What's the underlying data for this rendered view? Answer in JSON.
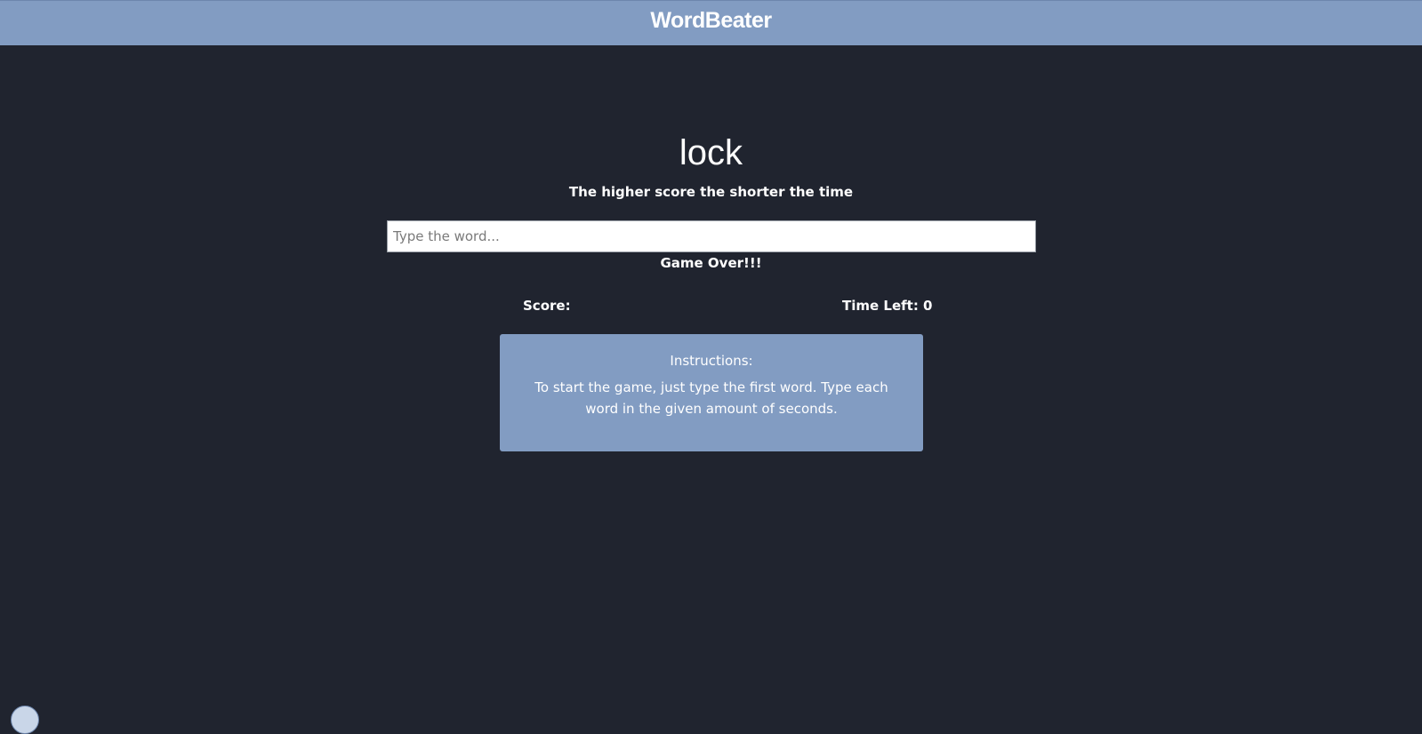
{
  "header": {
    "brand": "WordBeater"
  },
  "game": {
    "current_word": "lock",
    "tagline": "The higher score the shorter the time",
    "input_value": "",
    "input_placeholder": "Type the word...",
    "message": "Game Over!!!",
    "score_label": "Score:",
    "time_left_label": "Time Left: 0"
  },
  "instructions": {
    "title": "Instructions:",
    "body": "To start the game, just type the first word. Type each word in the given amount of seconds."
  },
  "colors": {
    "background": "#20242f",
    "accent": "#829cc2",
    "text": "#ffffff"
  }
}
